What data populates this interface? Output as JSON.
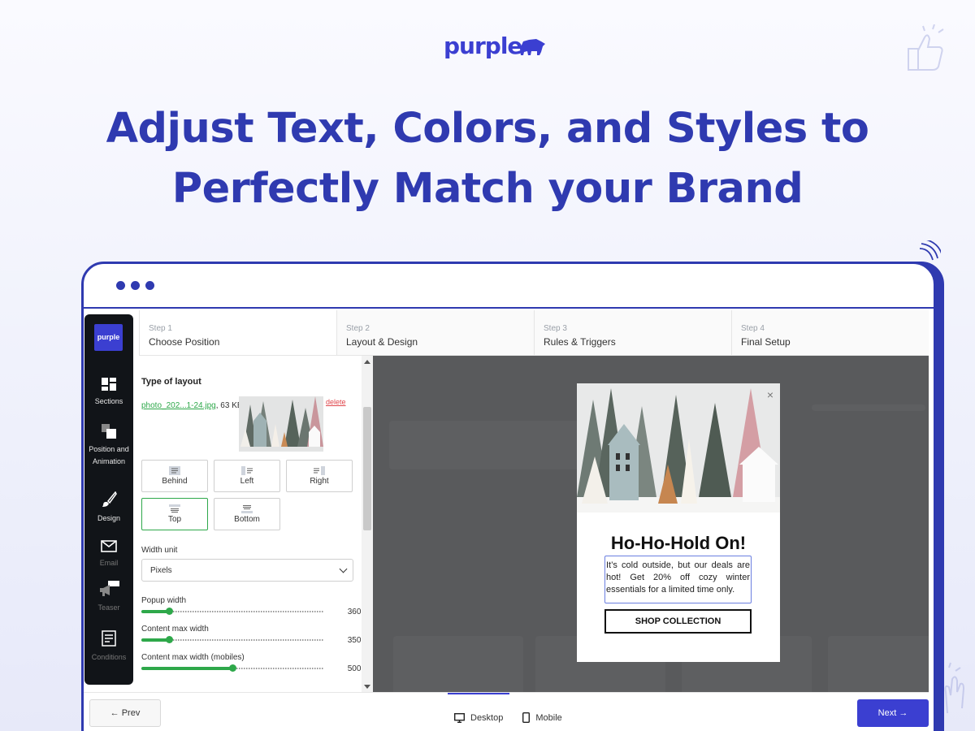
{
  "brand": {
    "logo_text": "purple"
  },
  "headline": {
    "line1": "Adjust Text, Colors, and Styles to",
    "line2": "Perfectly Match your Brand"
  },
  "sidebar": {
    "logo_text": "purple",
    "items": [
      {
        "label": "Sections",
        "icon": "sections-icon"
      },
      {
        "label": "Position and Animation",
        "icon": "position-icon"
      },
      {
        "label": "Design",
        "icon": "brush-icon"
      },
      {
        "label": "Email",
        "icon": "envelope-icon"
      },
      {
        "label": "Teaser",
        "icon": "megaphone-icon",
        "badge": "Teaser"
      },
      {
        "label": "Conditions",
        "icon": "conditions-icon"
      }
    ]
  },
  "steps": [
    {
      "num": "Step 1",
      "title": "Choose Position"
    },
    {
      "num": "Step 2",
      "title": "Layout & Design"
    },
    {
      "num": "Step 3",
      "title": "Rules & Triggers"
    },
    {
      "num": "Step 4",
      "title": "Final Setup"
    }
  ],
  "panel": {
    "heading": "Type of layout",
    "file_name": "photo_202...1-24.jpg",
    "file_size": ", 63 KB",
    "delete_label": "delete",
    "layouts": [
      "Behind",
      "Left",
      "Right",
      "Top",
      "Bottom"
    ],
    "selected_layout": "Top",
    "width_unit_label": "Width unit",
    "width_unit_value": "Pixels",
    "sliders": [
      {
        "label": "Popup width",
        "value": "360px",
        "level": 0.15
      },
      {
        "label": "Content max width",
        "value": "350px",
        "level": 0.15
      },
      {
        "label": "Content max width (mobiles)",
        "value": "500px",
        "level": 0.5
      }
    ]
  },
  "popup": {
    "close": "×",
    "title": "Ho-Ho-Hold On!",
    "body": "It’s cold outside, but our deals are hot! Get 20% off cozy winter essentials for a limited time only.",
    "cta": "SHOP COLLECTION"
  },
  "bottom": {
    "prev_label": "← Prev",
    "desktop_label": "Desktop",
    "mobile_label": "Mobile",
    "next_label": "Next →"
  },
  "colors": {
    "brand": "#2f3ab0",
    "accent": "#3b3fd1",
    "green": "#2ea84a"
  }
}
